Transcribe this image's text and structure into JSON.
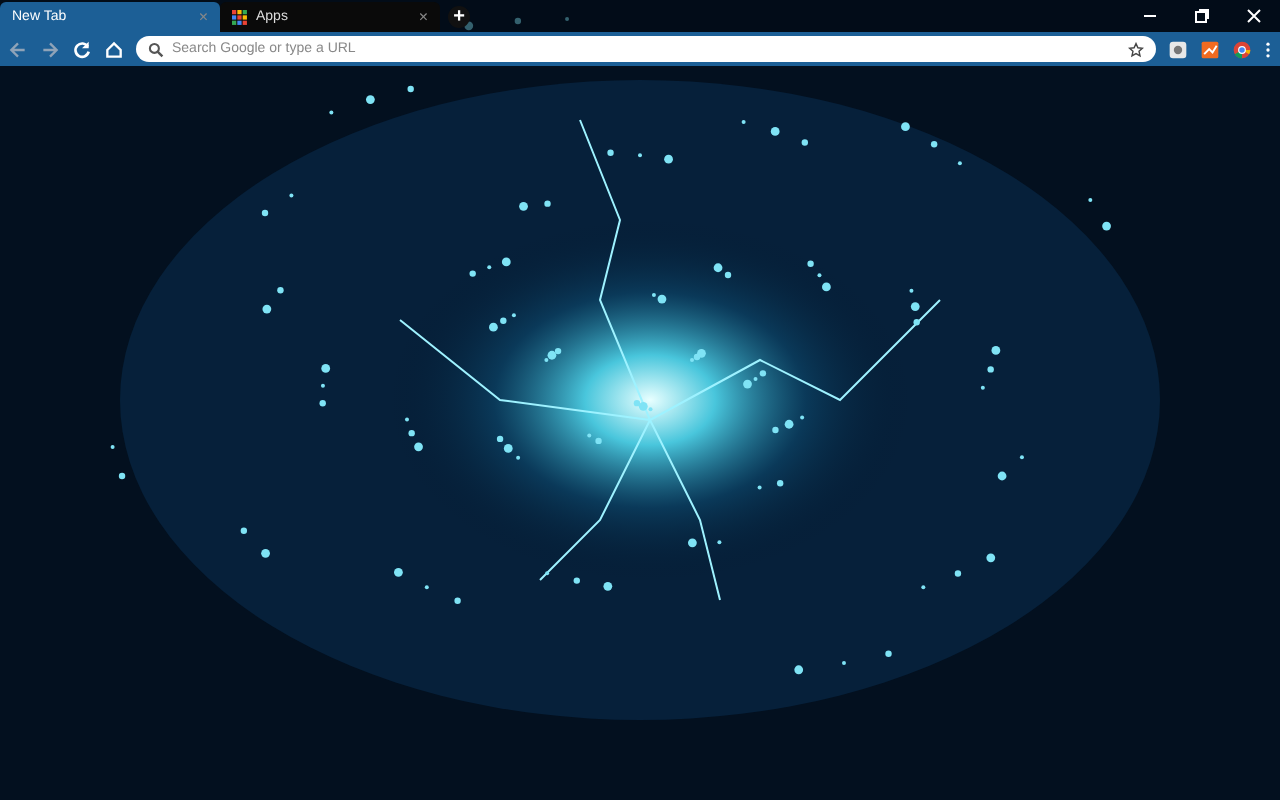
{
  "tabs": [
    {
      "label": "New Tab",
      "selected": true,
      "close": "×",
      "kind": "page"
    },
    {
      "label": "Apps",
      "selected": false,
      "close": "×",
      "kind": "apps"
    }
  ],
  "new_tab": "+",
  "address_bar": {
    "placeholder": "Search Google or type a URL"
  }
}
